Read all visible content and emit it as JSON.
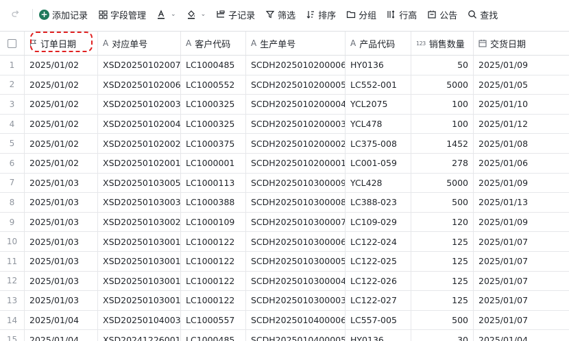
{
  "toolbar": {
    "items": [
      {
        "label": "添加记录",
        "icon": "plus-circle-icon"
      },
      {
        "label": "字段管理",
        "icon": "grid-icon"
      },
      {
        "label": "",
        "icon": "text-color-icon"
      },
      {
        "label": "",
        "icon": "fill-color-icon"
      },
      {
        "label": "子记录",
        "icon": "sub-record-icon"
      },
      {
        "label": "筛选",
        "icon": "filter-icon"
      },
      {
        "label": "排序",
        "icon": "sort-icon"
      },
      {
        "label": "分组",
        "icon": "folder-icon"
      },
      {
        "label": "行高",
        "icon": "row-height-icon"
      },
      {
        "label": "公告",
        "icon": "notice-icon"
      },
      {
        "label": "查找",
        "icon": "search-icon"
      }
    ]
  },
  "table": {
    "columns": [
      {
        "label": "订单日期",
        "icon": "flag-icon"
      },
      {
        "label": "对应单号",
        "icon": "text-field-icon"
      },
      {
        "label": "客户代码",
        "icon": "text-field-icon"
      },
      {
        "label": "生产单号",
        "icon": "text-field-icon"
      },
      {
        "label": "产品代码",
        "icon": "text-field-icon"
      },
      {
        "label": "销售数量",
        "icon": "number-field-icon",
        "prefix": "123"
      },
      {
        "label": "交货日期",
        "icon": "calendar-icon"
      }
    ],
    "rows": [
      {
        "n": "1",
        "c": [
          "2025/01/02",
          "XSD20250102007",
          "LC1000485",
          "SCDH2025010200006",
          "HY0136",
          "50",
          "2025/01/09"
        ]
      },
      {
        "n": "2",
        "c": [
          "2025/01/02",
          "XSD20250102006",
          "LC1000552",
          "SCDH2025010200005",
          "LC552-001",
          "5000",
          "2025/01/05"
        ]
      },
      {
        "n": "3",
        "c": [
          "2025/01/02",
          "XSD20250102003",
          "LC1000325",
          "SCDH2025010200004",
          "YCL2075",
          "100",
          "2025/01/10"
        ]
      },
      {
        "n": "4",
        "c": [
          "2025/01/02",
          "XSD20250102004",
          "LC1000325",
          "SCDH2025010200003",
          "YCL478",
          "100",
          "2025/01/12"
        ]
      },
      {
        "n": "5",
        "c": [
          "2025/01/02",
          "XSD20250102002",
          "LC1000375",
          "SCDH2025010200002",
          "LC375-008",
          "1452",
          "2025/01/08"
        ]
      },
      {
        "n": "6",
        "c": [
          "2025/01/02",
          "XSD20250102001",
          "LC1000001",
          "SCDH2025010200001",
          "LC001-059",
          "278",
          "2025/01/06"
        ]
      },
      {
        "n": "7",
        "c": [
          "2025/01/03",
          "XSD20250103005",
          "LC1000113",
          "SCDH2025010300009",
          "YCL428",
          "5000",
          "2025/01/09"
        ]
      },
      {
        "n": "8",
        "c": [
          "2025/01/03",
          "XSD20250103003",
          "LC1000388",
          "SCDH2025010300008",
          "LC388-023",
          "500",
          "2025/01/13"
        ]
      },
      {
        "n": "9",
        "c": [
          "2025/01/03",
          "XSD20250103002",
          "LC1000109",
          "SCDH2025010300007",
          "LC109-029",
          "120",
          "2025/01/09"
        ]
      },
      {
        "n": "10",
        "c": [
          "2025/01/03",
          "XSD20250103001",
          "LC1000122",
          "SCDH2025010300006",
          "LC122-024",
          "125",
          "2025/01/07"
        ]
      },
      {
        "n": "11",
        "c": [
          "2025/01/03",
          "XSD20250103001",
          "LC1000122",
          "SCDH2025010300005",
          "LC122-025",
          "125",
          "2025/01/07"
        ]
      },
      {
        "n": "12",
        "c": [
          "2025/01/03",
          "XSD20250103001",
          "LC1000122",
          "SCDH2025010300004",
          "LC122-026",
          "125",
          "2025/01/07"
        ]
      },
      {
        "n": "13",
        "c": [
          "2025/01/03",
          "XSD20250103001",
          "LC1000122",
          "SCDH2025010300003",
          "LC122-027",
          "125",
          "2025/01/07"
        ]
      },
      {
        "n": "14",
        "c": [
          "2025/01/04",
          "XSD20250104003",
          "LC1000557",
          "SCDH2025010400006",
          "LC557-005",
          "500",
          "2025/01/07"
        ]
      },
      {
        "n": "15",
        "c": [
          "2025/01/04",
          "XSD20241226001",
          "LC1000485",
          "SCDH2025010400005",
          "HY0136",
          "30",
          "2025/01/04"
        ]
      }
    ]
  },
  "colors": {
    "accent": "#1f7a5c",
    "highlight": "#e02020",
    "grid_line": "#e6e7ea"
  }
}
